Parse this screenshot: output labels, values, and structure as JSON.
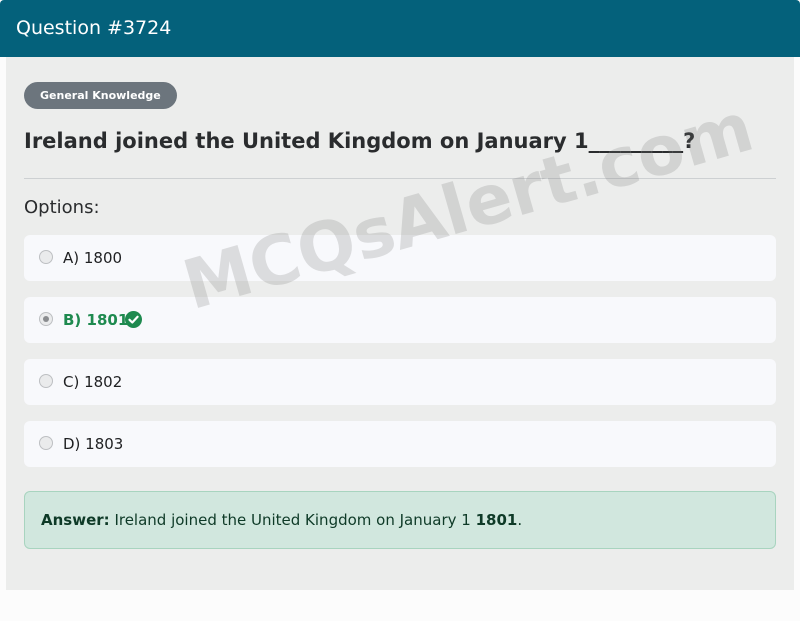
{
  "header": {
    "title": "Question #3724"
  },
  "category": {
    "label": "General Knowledge"
  },
  "question": {
    "text": "Ireland joined the United Kingdom on January 1_________?"
  },
  "options_section": {
    "label": "Options:"
  },
  "options": [
    {
      "label": "A) 1800",
      "selected": false,
      "correct": false
    },
    {
      "label": "B) 1801",
      "selected": true,
      "correct": true
    },
    {
      "label": "C) 1802",
      "selected": false,
      "correct": false
    },
    {
      "label": "D) 1803",
      "selected": false,
      "correct": false
    }
  ],
  "answer": {
    "prefix": "Answer:",
    "text": "Ireland joined the United Kingdom on January 1",
    "value": "1801",
    "suffix": "."
  },
  "watermark": {
    "text": "MCQsAlert.com"
  },
  "colors": {
    "header_bg": "#04617b",
    "badge_bg": "#6c757d",
    "correct_green": "#1e8a4f",
    "answer_bg": "#d1e7de"
  },
  "icons": {
    "correct": "check-circle-icon"
  }
}
